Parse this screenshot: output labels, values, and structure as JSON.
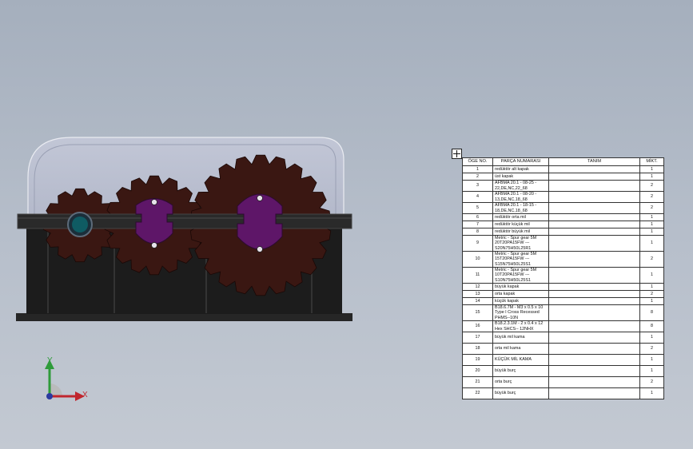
{
  "viewport": {
    "triad": {
      "x_label": "X",
      "y_label": "Y",
      "x_color": "#c0262e",
      "y_color": "#2e9b3a",
      "z_color": "#2b3aa0"
    }
  },
  "colors": {
    "background": "#b4bcc8",
    "housing": "#1f1f1f",
    "gear": "#3a1712",
    "hub": "#5e1668",
    "bearing": "#0f5b63",
    "cover": "#bdc2d3"
  },
  "bom": {
    "headers": [
      "ÖGE NO.",
      "PARÇA NUMARASI",
      "TANIM",
      "MİKT."
    ],
    "rows": [
      {
        "no": "1",
        "part": "redüktör alt kapak",
        "desc": "",
        "qty": "1"
      },
      {
        "no": "2",
        "part": "üst kapak",
        "desc": "",
        "qty": "1"
      },
      {
        "no": "3",
        "part": "AFBMA 20.1 - 08-25 - 22,DE,NC,22_68",
        "desc": "",
        "qty": "2"
      },
      {
        "no": "4",
        "part": "AFBMA 20.1 - 08-20 - 13,DE,NC,18_68",
        "desc": "",
        "qty": "2"
      },
      {
        "no": "5",
        "part": "AFBMA 20.1 - 18-15 - 18,DE,NC,18_68",
        "desc": "",
        "qty": "2"
      },
      {
        "no": "6",
        "part": "redüktör orta mil",
        "desc": "",
        "qty": "1"
      },
      {
        "no": "7",
        "part": "redüktör küçük mil",
        "desc": "",
        "qty": "1"
      },
      {
        "no": "8",
        "part": "redüktör büyük mil",
        "desc": "",
        "qty": "1"
      },
      {
        "no": "9",
        "part": "Metric - Spur gear 5M 20T20PA15FW --- S20N75H50L25R1",
        "desc": "",
        "qty": "1"
      },
      {
        "no": "10",
        "part": "Metric - Spur gear 5M 15T20PA15FW --- S15N75H50L25S1",
        "desc": "",
        "qty": "2"
      },
      {
        "no": "11",
        "part": "Metric - Spur gear 5M 10T20PA15FW --- S10N75H50L25S1",
        "desc": "",
        "qty": "1"
      },
      {
        "no": "12",
        "part": "büyük kapak",
        "desc": "",
        "qty": "1"
      },
      {
        "no": "13",
        "part": "orta kapak",
        "desc": "",
        "qty": "2"
      },
      {
        "no": "14",
        "part": "küçük kapak",
        "desc": "",
        "qty": "1"
      },
      {
        "no": "15",
        "part": "B18.6.7M - M3 x 0.5 x 10 Type I Cross Recessed PHMS--10N",
        "desc": "",
        "qty": "8"
      },
      {
        "no": "16",
        "part": "B18.2.3.1M - 2 x 0.4 x 12 Hex SHCS-- 12NHX",
        "desc": "",
        "qty": "8"
      },
      {
        "no": "17",
        "part": "büyük mil kama",
        "desc": "",
        "qty": "1"
      },
      {
        "no": "18",
        "part": "orta mil kama",
        "desc": "",
        "qty": "2"
      },
      {
        "no": "19",
        "part": "KÜÇÜK MİL KAMA",
        "desc": "",
        "qty": "1"
      },
      {
        "no": "20",
        "part": "büyük burç",
        "desc": "",
        "qty": "1"
      },
      {
        "no": "21",
        "part": "orta burç",
        "desc": "",
        "qty": "2"
      },
      {
        "no": "22",
        "part": "büyük burç",
        "desc": "",
        "qty": "1"
      }
    ]
  }
}
